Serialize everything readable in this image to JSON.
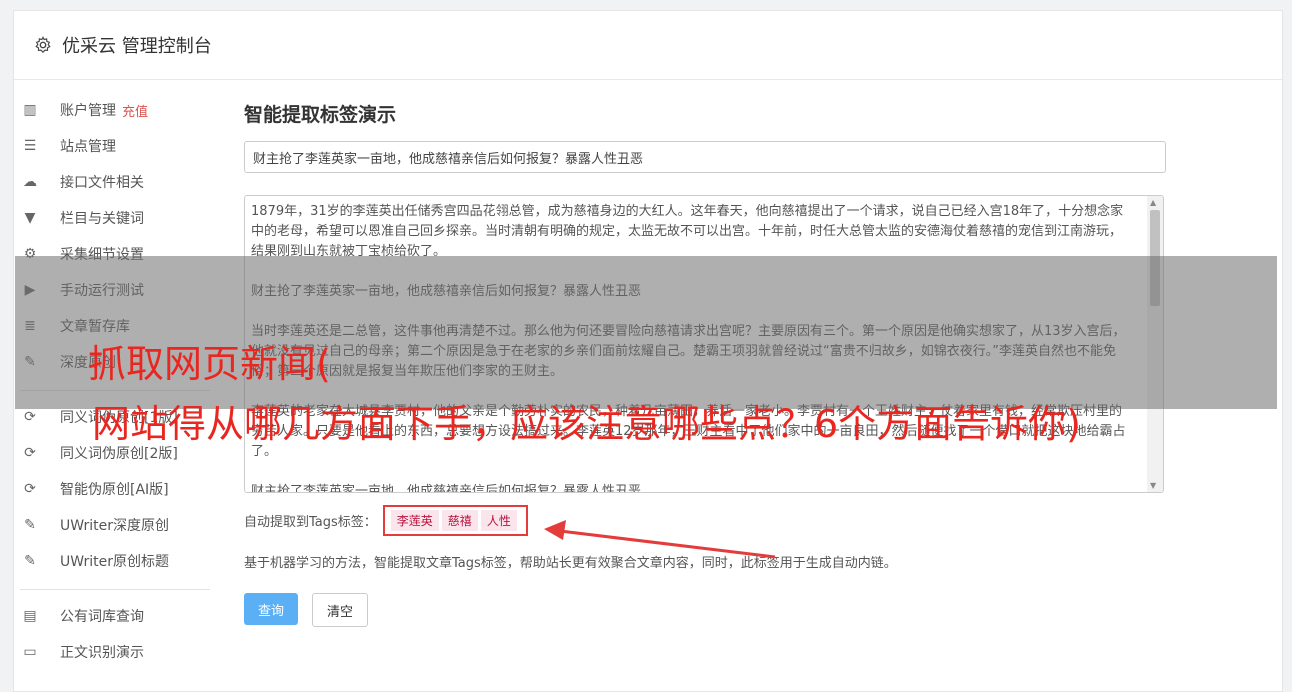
{
  "header": {
    "title": "优采云 管理控制台",
    "icon": "gear-icon"
  },
  "sidebar": {
    "items": [
      {
        "label": "账户管理",
        "badge": "充值",
        "icon": "bar-chart-icon",
        "glyph": "▥"
      },
      {
        "label": "站点管理",
        "icon": "server-icon",
        "glyph": "☰"
      },
      {
        "label": "接口文件相关",
        "icon": "cloud-upload-icon",
        "glyph": "☁"
      },
      {
        "label": "栏目与关键词",
        "icon": "filter-icon",
        "glyph": "▼"
      },
      {
        "label": "采集细节设置",
        "icon": "gears-icon",
        "glyph": "⚙"
      },
      {
        "label": "手动运行测试",
        "icon": "play-icon",
        "glyph": "▶"
      },
      {
        "label": "文章暂存库",
        "icon": "database-icon",
        "glyph": "≣"
      },
      {
        "label": "深度原创",
        "icon": "edit-icon",
        "glyph": "✎"
      }
    ],
    "items2": [
      {
        "label": "同义词伪原创[1版]",
        "icon": "refresh-icon",
        "glyph": "⟳"
      },
      {
        "label": "同义词伪原创[2版]",
        "icon": "refresh-icon",
        "glyph": "⟳"
      },
      {
        "label": "智能伪原创[AI版]",
        "icon": "refresh-icon",
        "glyph": "⟳"
      },
      {
        "label": "UWriter深度原创",
        "icon": "edit-icon",
        "glyph": "✎"
      },
      {
        "label": "UWriter原创标题",
        "icon": "edit-icon",
        "glyph": "✎"
      }
    ],
    "items3": [
      {
        "label": "公有词库查询",
        "icon": "book-icon",
        "glyph": "▤"
      },
      {
        "label": "正文识别演示",
        "icon": "window-icon",
        "glyph": "▭"
      }
    ]
  },
  "main": {
    "title": "智能提取标签演示",
    "input_value": "财主抢了李莲英家一亩地，他成慈禧亲信后如何报复？暴露人性丑恶",
    "content_paragraphs": [
      "1879年，31岁的李莲英出任储秀宫四品花翎总管，成为慈禧身边的大红人。这年春天，他向慈禧提出了一个请求，说自己已经入宫18年了，十分想念家中的老母，希望可以恩准自己回乡探亲。当时清朝有明确的规定，太监无故不可以出宫。十年前，时任大总管太监的安德海仗着慈禧的宠信到江南游玩，结果刚到山东就被丁宝桢给砍了。",
      "财主抢了李莲英家一亩地，他成慈禧亲信后如何报复？暴露人性丑恶",
      "当时李莲英还是二总管，这件事他再清楚不过。那么他为何还要冒险向慈禧请求出宫呢？主要原因有三个。第一个原因是他确实想家了，从13岁入宫后，他就没有见过自己的母亲；第二个原因是急于在老家的乡亲们面前炫耀自己。楚霸王项羽就曾经说过“富贵不归故乡，如锦衣夜行。”李莲英自然也不能免俗；第三个原因就是报复当年欺压他们李家的王财主。",
      "李莲英的老家在大城县李贾村，他的父亲是个勤劳朴实的农民，种着几亩薄田，养活一家老小。李贾村有一个王姓财主，仗着家里有钱，经常欺压村里的穷苦人家。只要是他看上的东西，总要想方设法搞过来。李莲英12岁那年，王财主看中了他们家中的一亩良田，然后随便找了一个借口就把这块地给霸占了。",
      "财主抢了李莲英家一亩地，他成慈禧亲信后如何报复？暴露人性丑恶"
    ],
    "tags_label": "自动提取到Tags标签：",
    "tags": [
      "李莲英",
      "慈禧",
      "人性"
    ],
    "description": "基于机器学习的方法，智能提取文章Tags标签，帮助站长更有效聚合文章内容，同时，此标签用于生成自动内链。",
    "query_button": "查询",
    "clear_button": "清空"
  },
  "overlay": {
    "line1": "抓取网页新闻(",
    "line2": "网站得从哪几方面下手，应该注意哪些点？6个方面告诉你)",
    "color": "#e9261f"
  }
}
